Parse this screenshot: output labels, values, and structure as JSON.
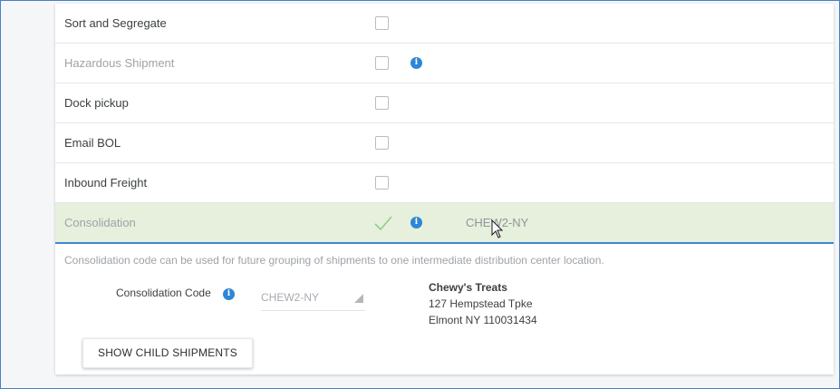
{
  "options": [
    {
      "label": "Sort and Segregate"
    },
    {
      "label": "Hazardous Shipment"
    },
    {
      "label": "Dock pickup"
    },
    {
      "label": "Email BOL"
    },
    {
      "label": "Inbound Freight"
    },
    {
      "label": "Consolidation",
      "value": "CHEW2-NY"
    }
  ],
  "details": {
    "description": "Consolidation code can be used for future grouping of shipments to one intermediate distribution center location.",
    "code_label": "Consolidation Code",
    "code_value": "CHEW2-NY",
    "address": {
      "name": "Chewy's Treats",
      "street": "127 Hempstead Tpke",
      "city": "Elmont NY 110031434"
    },
    "button_label": "SHOW CHILD SHIPMENTS"
  },
  "colors": {
    "accent": "#2e86d6",
    "selected_row": "#e6f0dc",
    "check": "#8fcf8a"
  },
  "icons": {
    "info": "info-icon",
    "check": "check-icon",
    "cursor": "cursor-icon",
    "dropdown": "dropdown-arrow-icon"
  }
}
